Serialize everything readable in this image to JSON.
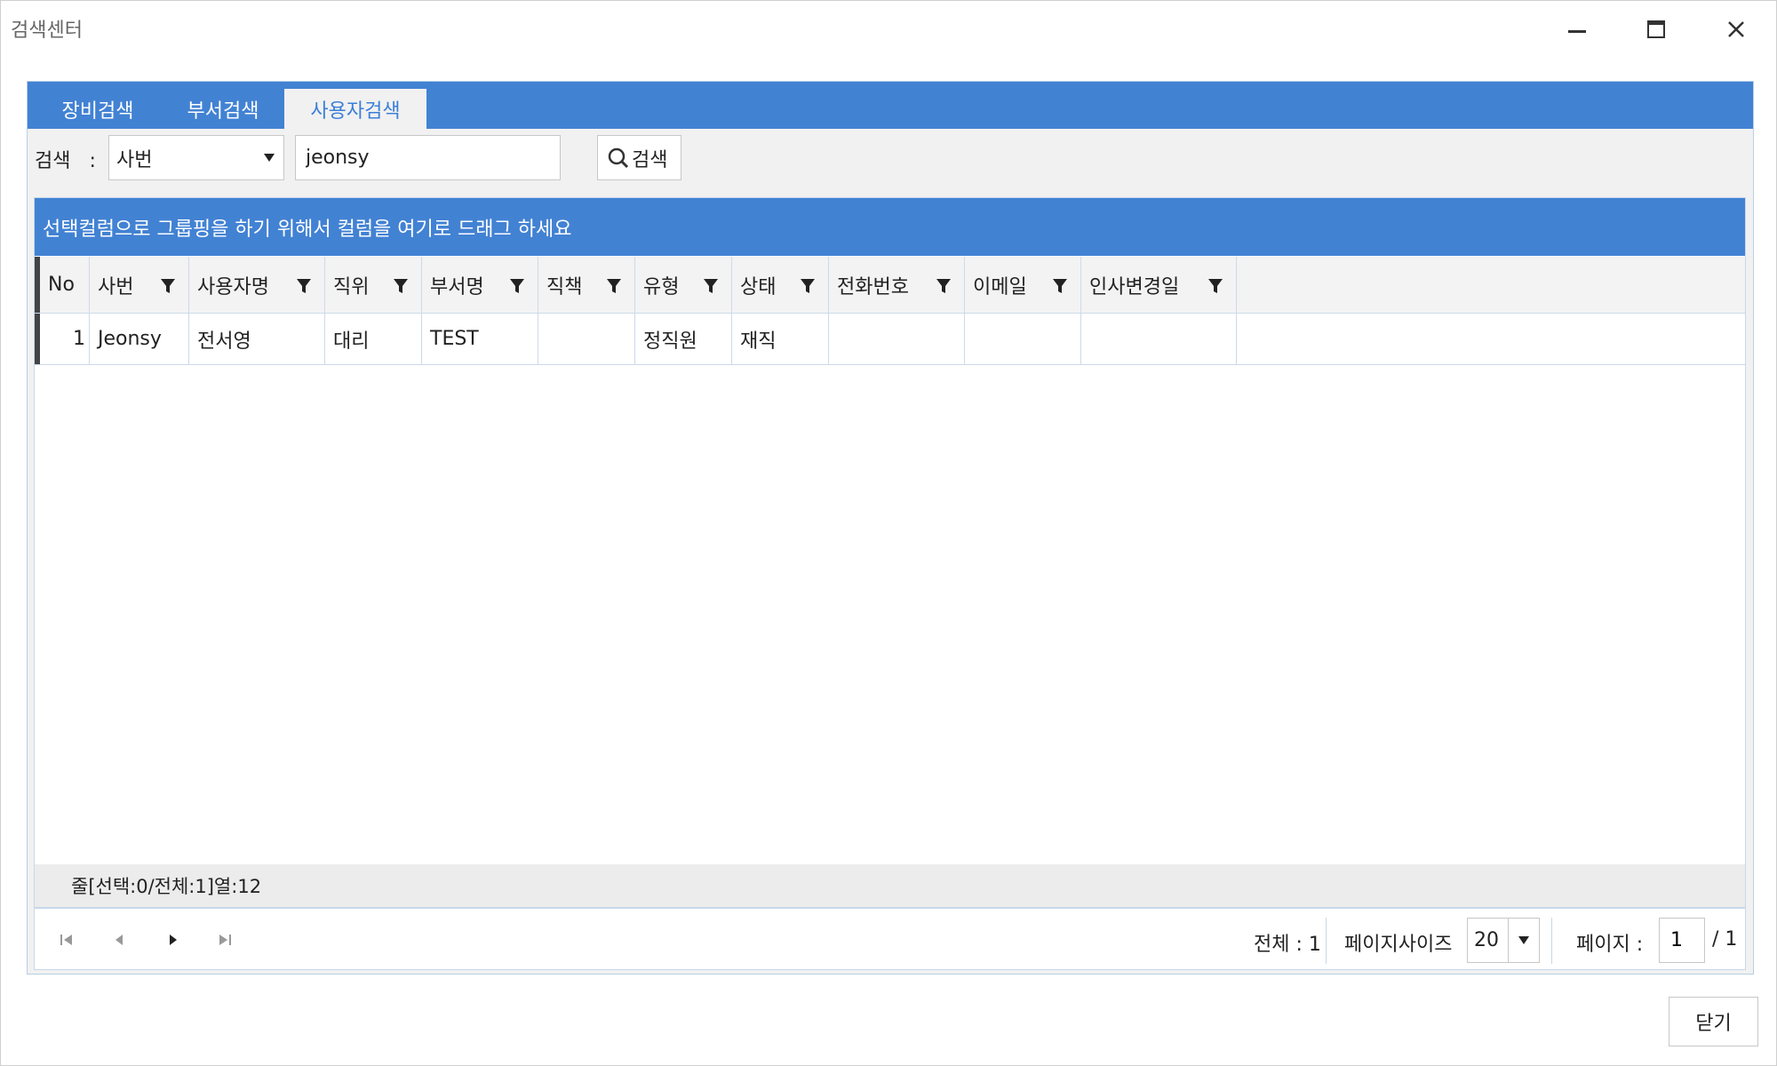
{
  "window": {
    "title": "검색센터",
    "minimize_icon": "minimize-icon",
    "maximize_icon": "maximize-icon",
    "close_icon": "close-icon"
  },
  "tabs": [
    {
      "label": "장비검색",
      "active": false
    },
    {
      "label": "부서검색",
      "active": false
    },
    {
      "label": "사용자검색",
      "active": true
    }
  ],
  "search": {
    "label": "검색",
    "colon": ":",
    "field_selected": "사번",
    "query_value": "jeonsy",
    "button_label": "검색",
    "button_icon": "search-icon"
  },
  "grid": {
    "group_hint": "선택컬럼으로 그룹핑을 하기 위해서 컬럼을 여기로 드래그 하세요",
    "columns": [
      {
        "label": "No",
        "filter": false
      },
      {
        "label": "사번",
        "filter": true
      },
      {
        "label": "사용자명",
        "filter": true
      },
      {
        "label": "직위",
        "filter": true
      },
      {
        "label": "부서명",
        "filter": true
      },
      {
        "label": "직책",
        "filter": true
      },
      {
        "label": "유형",
        "filter": true
      },
      {
        "label": "상태",
        "filter": true
      },
      {
        "label": "전화번호",
        "filter": true
      },
      {
        "label": "이메일",
        "filter": true
      },
      {
        "label": "인사변경일",
        "filter": true
      }
    ],
    "rows": [
      [
        "1",
        "Jeonsy",
        "전서영",
        "대리",
        "TEST",
        "",
        "정직원",
        "재직",
        "",
        "",
        ""
      ]
    ],
    "status": "줄[선택:0/전체:1]열:12"
  },
  "pager": {
    "total_label": "전체 : 1",
    "page_size_label": "페이지사이즈",
    "page_size_value": "20",
    "page_label": "페이지 :",
    "page_value": "1",
    "page_total": "/ 1"
  },
  "footer": {
    "close_label": "닫기"
  },
  "colors": {
    "accent": "#4282d3",
    "active_tab_text": "#3b7fd8",
    "panel_bg": "#f1f1f1"
  }
}
